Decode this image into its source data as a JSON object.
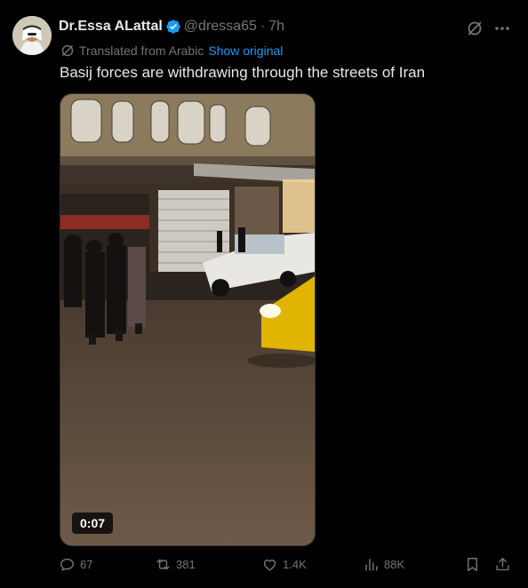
{
  "post": {
    "author_name": "Dr.Essa ALattal",
    "handle": "@dressa65",
    "separator": "·",
    "time": "7h",
    "translated_label": "Translated from Arabic",
    "show_original": "Show original",
    "text": "Basij forces are withdrawing through the streets of Iran"
  },
  "media": {
    "duration": "0:07"
  },
  "actions": {
    "replies": "67",
    "reposts": "381",
    "likes": "1.4K",
    "views": "88K"
  },
  "icons": {
    "verified": "verified-badge-icon",
    "grok": "grok-icon",
    "more": "more-options-icon",
    "translate": "translate-icon",
    "reply": "reply-icon",
    "repost": "repost-icon",
    "like": "heart-icon",
    "views": "views-icon",
    "bookmark": "bookmark-icon",
    "share": "share-icon"
  },
  "colors": {
    "background": "#000000",
    "text": "#e7e9ea",
    "secondary": "#71767b",
    "accent": "#1d9bf0"
  }
}
